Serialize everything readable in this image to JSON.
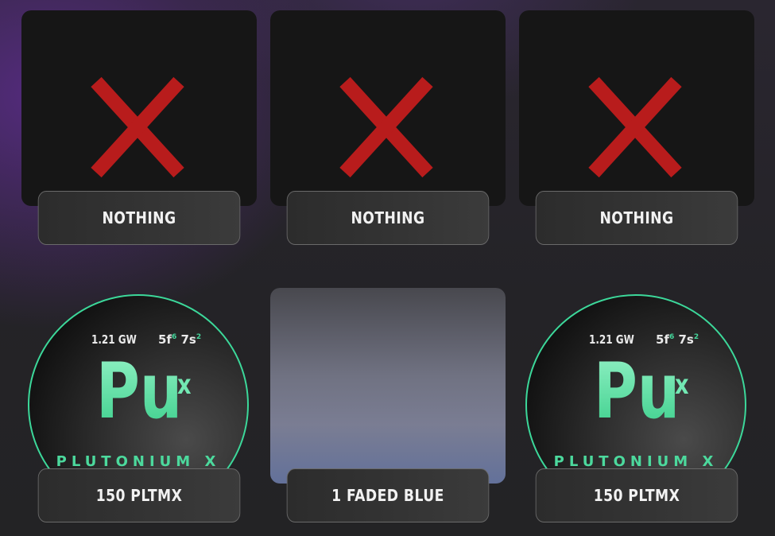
{
  "cards": [
    {
      "label": "NOTHING",
      "art": "x-mark-icon"
    },
    {
      "label": "NOTHING",
      "art": "x-mark-icon"
    },
    {
      "label": "NOTHING",
      "art": "x-mark-icon"
    },
    {
      "label": "150 PLTMX",
      "art": "plutonium-coin"
    },
    {
      "label": "1 FADED BLUE",
      "art": "faded-blue-swatch"
    },
    {
      "label": "150 PLTMX",
      "art": "plutonium-coin"
    }
  ],
  "coin": {
    "power": "1.21 GW",
    "config_a": "5f",
    "config_a_sup": "6",
    "config_b": "7s",
    "config_b_sup": "2",
    "symbol": "Pu",
    "symbol_suffix": "x",
    "name": "PLUTONIUM X"
  },
  "colors": {
    "x_mark": "#b81c1c",
    "coin_accent": "#3cd89a",
    "label_text": "#f2f2f2"
  }
}
